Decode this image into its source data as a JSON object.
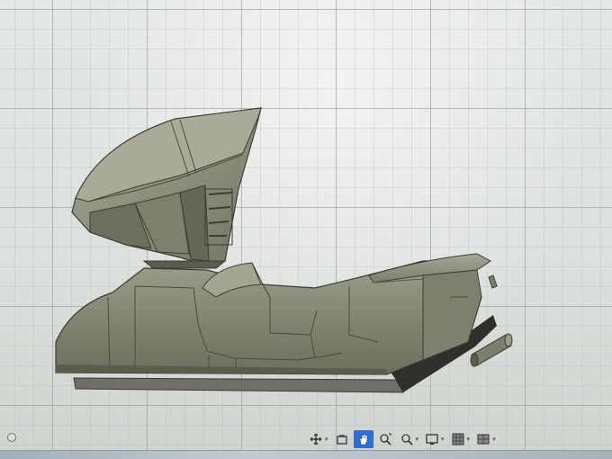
{
  "app": {
    "view": "3D viewport"
  },
  "viewport": {
    "grid": true,
    "background": "#e2e6e2",
    "model_color": "#8c8e7c"
  },
  "nav_toolbar": {
    "items": [
      {
        "icon": "orbit-icon",
        "has_dropdown": true
      },
      {
        "icon": "look-at-icon",
        "has_dropdown": false
      },
      {
        "icon": "pan-hand-icon",
        "has_dropdown": false,
        "active": true
      },
      {
        "icon": "zoom-window-icon",
        "has_dropdown": false
      },
      {
        "icon": "zoom-icon",
        "has_dropdown": true
      },
      {
        "icon": "display-settings-icon",
        "has_dropdown": true
      },
      {
        "icon": "grid-snap-icon",
        "has_dropdown": true
      },
      {
        "icon": "viewports-icon",
        "has_dropdown": true
      }
    ],
    "accent": "#2f6fcf"
  }
}
